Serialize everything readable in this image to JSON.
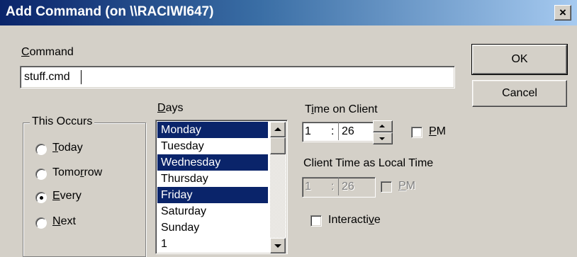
{
  "window": {
    "title": "Add Command (on \\\\RACIWI647)",
    "close_label": "×"
  },
  "command": {
    "label_accel": "C",
    "label_rest": "ommand",
    "value": "stuff.cmd"
  },
  "buttons": {
    "ok": "OK",
    "cancel": "Cancel"
  },
  "occurs": {
    "group_label": "This Occurs",
    "options": [
      {
        "accel": "T",
        "rest": "oday",
        "selected": false
      },
      {
        "pre": "Tomo",
        "accel": "r",
        "rest": "row",
        "selected": false
      },
      {
        "accel": "E",
        "rest": "very",
        "selected": true
      },
      {
        "accel": "N",
        "rest": "ext",
        "selected": false
      }
    ]
  },
  "days": {
    "label_accel": "D",
    "label_rest": "ays",
    "items": [
      {
        "label": "Monday",
        "selected": true
      },
      {
        "label": "Tuesday",
        "selected": false
      },
      {
        "label": "Wednesday",
        "selected": true
      },
      {
        "label": "Thursday",
        "selected": false
      },
      {
        "label": "Friday",
        "selected": true
      },
      {
        "label": "Saturday",
        "selected": false
      },
      {
        "label": "Sunday",
        "selected": false
      },
      {
        "label": "1",
        "selected": false
      }
    ]
  },
  "time_on_client": {
    "label_pre": "T",
    "label_accel": "i",
    "label_rest": "me on Client",
    "hour": "1",
    "separator": ":",
    "minute": "26",
    "pm_accel": "P",
    "pm_rest": "M",
    "pm_checked": false
  },
  "local_time": {
    "label": "Client Time as Local Time",
    "hour": "1",
    "separator": ":",
    "minute": "26",
    "pm_accel": "P",
    "pm_rest": "M",
    "pm_checked": false
  },
  "interactive": {
    "label_pre": "Interacti",
    "label_accel": "v",
    "label_rest": "e",
    "checked": false
  },
  "colors": {
    "title_start": "#0a246a",
    "title_end": "#a6caf0",
    "selection": "#0a246a",
    "face": "#d4d0c8"
  }
}
